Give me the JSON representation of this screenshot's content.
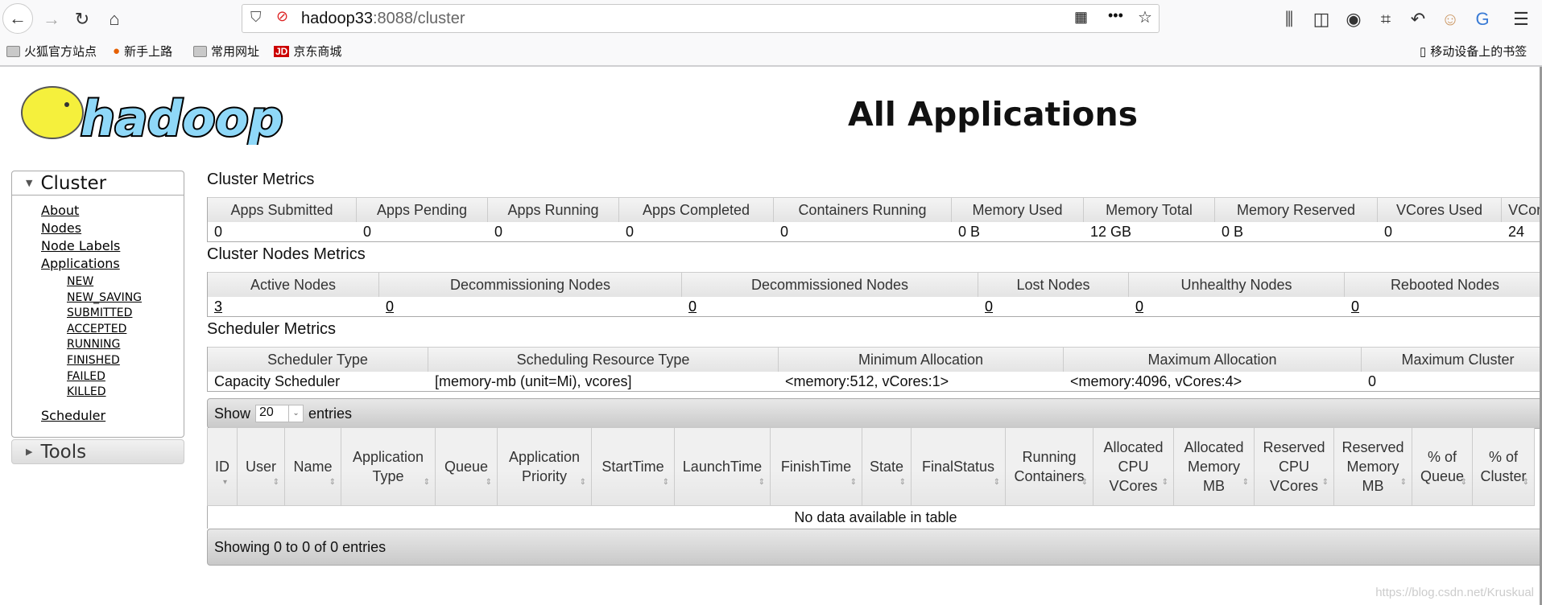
{
  "browser": {
    "url_host": "hadoop33",
    "url_rest": ":8088/cluster",
    "bookmarks": [
      "火狐官方站点",
      "新手上路",
      "常用网址",
      "京东商城"
    ],
    "mobile_bookmarks": "移动设备上的书签"
  },
  "page": {
    "title": "All Applications",
    "logo_text": "hadoop"
  },
  "sidebar": {
    "cluster": "Cluster",
    "links": [
      "About",
      "Nodes",
      "Node Labels",
      "Applications"
    ],
    "states": [
      "NEW",
      "NEW_SAVING",
      "SUBMITTED",
      "ACCEPTED",
      "RUNNING",
      "FINISHED",
      "FAILED",
      "KILLED"
    ],
    "scheduler": "Scheduler",
    "tools": "Tools"
  },
  "cluster_metrics": {
    "heading": "Cluster Metrics",
    "headers": [
      "Apps Submitted",
      "Apps Pending",
      "Apps Running",
      "Apps Completed",
      "Containers Running",
      "Memory Used",
      "Memory Total",
      "Memory Reserved",
      "VCores Used",
      "VCores Total"
    ],
    "values": [
      "0",
      "0",
      "0",
      "0",
      "0",
      "0 B",
      "12 GB",
      "0 B",
      "0",
      "24"
    ]
  },
  "node_metrics": {
    "heading": "Cluster Nodes Metrics",
    "headers": [
      "Active Nodes",
      "Decommissioning Nodes",
      "Decommissioned Nodes",
      "Lost Nodes",
      "Unhealthy Nodes",
      "Rebooted Nodes"
    ],
    "values": [
      "3",
      "0",
      "0",
      "0",
      "0",
      "0"
    ]
  },
  "scheduler_metrics": {
    "heading": "Scheduler Metrics",
    "headers": [
      "Scheduler Type",
      "Scheduling Resource Type",
      "Minimum Allocation",
      "Maximum Allocation",
      "Maximum Cluster"
    ],
    "values": [
      "Capacity Scheduler",
      "[memory-mb (unit=Mi), vcores]",
      "<memory:512, vCores:1>",
      "<memory:4096, vCores:4>",
      "0"
    ]
  },
  "apps_table": {
    "show": "Show",
    "page_size": "20",
    "entries": "entries",
    "columns": [
      "ID",
      "User",
      "Name",
      "Application Type",
      "Queue",
      "Application Priority",
      "StartTime",
      "LaunchTime",
      "FinishTime",
      "State",
      "FinalStatus",
      "Running Containers",
      "Allocated CPU VCores",
      "Allocated Memory MB",
      "Reserved CPU VCores",
      "Reserved Memory MB",
      "% of Queue",
      "% of Cluster"
    ],
    "empty": "No data available in table",
    "info": "Showing 0 to 0 of 0 entries"
  },
  "watermark": "https://blog.csdn.net/Kruskual"
}
